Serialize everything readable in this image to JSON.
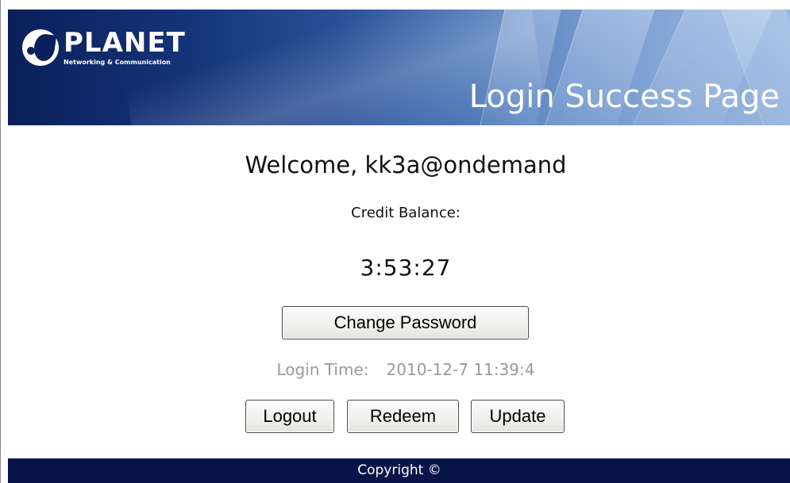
{
  "header": {
    "logo_text": "PLANET",
    "logo_tagline": "Networking & Communication",
    "page_title": "Login Success Page"
  },
  "main": {
    "welcome": "Welcome, kk3a@ondemand",
    "credit_label": "Credit Balance:",
    "credit_balance": "3:53:27",
    "change_password_label": "Change Password",
    "login_time_label": "Login Time:",
    "login_time_value": "2010-12-7 11:39:4",
    "logout_label": "Logout",
    "redeem_label": "Redeem",
    "update_label": "Update"
  },
  "footer": {
    "copyright": "Copyright ©"
  },
  "colors": {
    "header_dark": "#0b1f5a",
    "header_light": "#9ab6de",
    "footer_bg": "#0b1448",
    "muted_text": "#9a9a9a"
  }
}
